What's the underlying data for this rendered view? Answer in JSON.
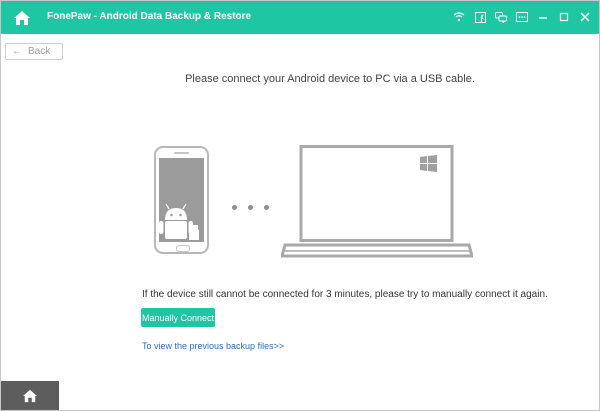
{
  "titlebar": {
    "app_title": "FonePaw - Android Data Backup & Restore",
    "icons": [
      "home-icon",
      "wifi-icon",
      "facebook-icon",
      "chat-icon",
      "feedback-icon",
      "minimize-icon",
      "maximize-icon",
      "close-icon"
    ]
  },
  "nav": {
    "back_label": "Back"
  },
  "main": {
    "headline": "Please connect your Android device to PC via a USB cable.",
    "notice": "If the device still cannot be connected for 3 minutes, please try to manually connect it again.",
    "manual_connect_label": "Manually Connect",
    "previous_backup_link": "To view the previous backup files>>"
  },
  "colors": {
    "accent": "#1fc6a4",
    "link": "#2a6fbf",
    "footer": "#5d5d5d"
  }
}
